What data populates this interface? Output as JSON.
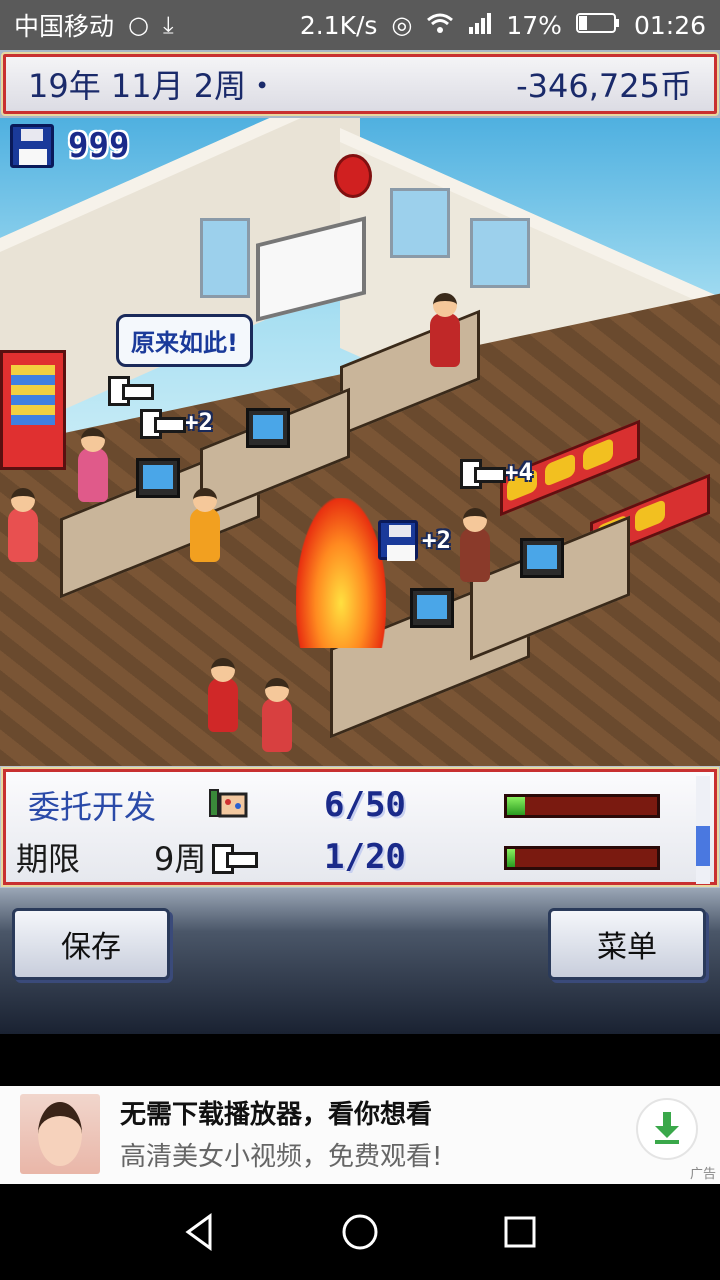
{
  "status_bar": {
    "carrier": "中国移动",
    "net_speed": "2.1K/s",
    "battery": "17%",
    "time": "01:26"
  },
  "hud": {
    "date": "19年 11月 2周・",
    "money": "-346,725币"
  },
  "scene": {
    "save_count": "999",
    "speech_bubble": "原来如此!",
    "floaters": [
      "+2",
      "+4",
      "+2"
    ]
  },
  "project": {
    "title": "委托开发",
    "deadline_label": "期限",
    "deadline_value": "9周",
    "row1_value": "6/50",
    "row2_value": "1/20",
    "row1_progress": 0.12,
    "row2_progress": 0.05
  },
  "buttons": {
    "save": "保存",
    "menu": "菜单"
  },
  "ad": {
    "title": "无需下载播放器，看你想看",
    "subtitle": "高清美女小视频，免费观看!",
    "tag": "广告",
    "accent": "#3aa84a"
  },
  "icons": {
    "status": [
      "message-icon",
      "download-icon",
      "no-sim-icon",
      "wifi-icon",
      "signal-icon",
      "battery-icon"
    ],
    "nav": [
      "back-icon",
      "home-icon",
      "recent-apps-icon"
    ]
  }
}
